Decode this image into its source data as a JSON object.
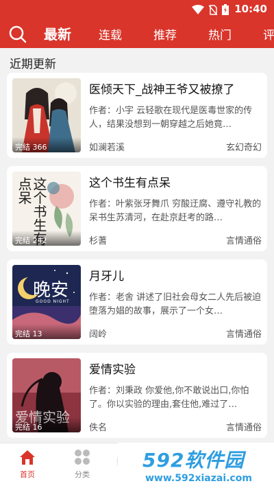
{
  "status_bar": {
    "time": "10:40"
  },
  "top_nav": {
    "tabs": [
      {
        "label": "最新",
        "active": true
      },
      {
        "label": "连载",
        "active": false
      },
      {
        "label": "推荐",
        "active": false
      },
      {
        "label": "热门",
        "active": false
      },
      {
        "label": "评",
        "active": false
      }
    ]
  },
  "section": {
    "title": "近期更新"
  },
  "books": [
    {
      "title": "医倾天下_战神王爷又被撩了",
      "desc": "作者：小宇 云轻歌在现代是医毒世家的传人，结果没想到一朝穿越之后她竟…",
      "author": "如澜若溪",
      "genre": "玄幻奇幻",
      "badge": "完结 366"
    },
    {
      "title": "这个书生有点呆",
      "desc": "作者：叶紫张牙舞爪 穷酸迂腐、遵守礼教的呆书生苏清河，在赴京赶考的路…",
      "author": "杉蓍",
      "genre": "言情通俗",
      "badge": "完结 242",
      "cover_text": "这个书生有点呆"
    },
    {
      "title": "月牙儿",
      "desc": "作者：老舍 讲述了旧社会母女二人先后被迫堕落为娼的故事，展示了一个女…",
      "author": "阔岭",
      "genre": "言情通俗",
      "badge": "完结 13",
      "cover_text": "晚安",
      "cover_sub": "GOOD NIGHT"
    },
    {
      "title": "爱情实验",
      "desc": "作者：刘秉政 你爱他,你不敢说出口,你怕了。你以实验的理由,套住他,难过了…",
      "author": "佚名",
      "genre": "言情通俗",
      "badge": "完结 16",
      "cover_text": "爱情实验"
    }
  ],
  "bottom_nav": {
    "items": [
      {
        "label": "首页",
        "active": true
      },
      {
        "label": "分类",
        "active": false
      }
    ]
  },
  "watermark": {
    "big": "592软件园",
    "small": "www.592xiazai.com"
  },
  "colors": {
    "brand": "#d9352b",
    "watermark": "#2f9ee0"
  }
}
